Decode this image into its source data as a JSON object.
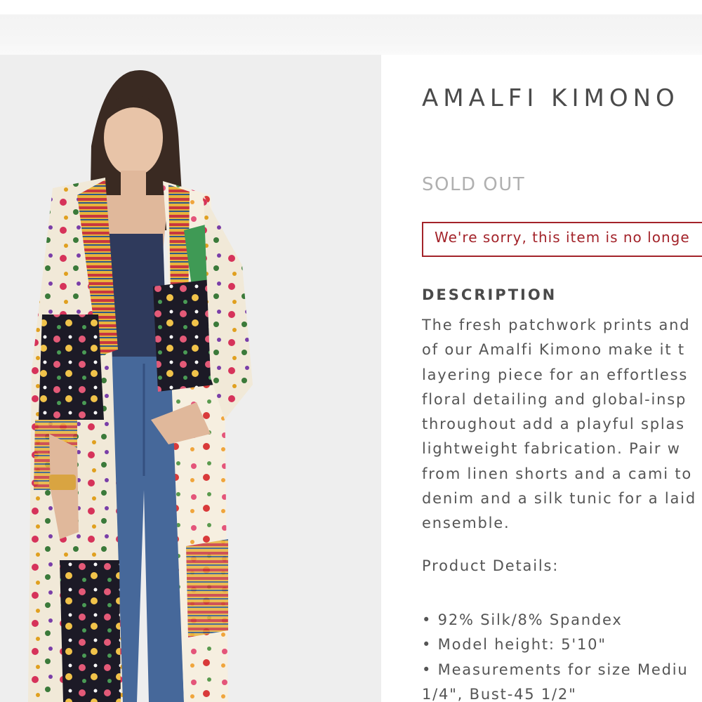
{
  "product": {
    "title": "AMALFI KIMONO",
    "status": "SOLD OUT",
    "alert_message": "We're sorry, this item is no longe",
    "image_alt": "Model wearing Amalfi Kimono"
  },
  "description": {
    "heading": "DESCRIPTION",
    "lines": [
      "The fresh patchwork prints and",
      "of our Amalfi Kimono make it t",
      "layering piece for an effortless",
      "floral detailing and global-insp",
      "throughout add a playful splas",
      "lightweight fabrication. Pair w",
      "from linen shorts and a cami to",
      "denim and a silk tunic for a laid",
      "ensemble."
    ],
    "product_details_label": "Product Details:",
    "bullets": [
      "• 92% Silk/8% Spandex",
      "• Model height: 5'10\"",
      "• Measurements for size Mediu",
      "1/4\", Bust-45 1/2\""
    ]
  },
  "colors": {
    "alert": "#a3232a",
    "sold_out": "#b0b0b0",
    "text": "#555555",
    "heading": "#4a4a4a"
  }
}
